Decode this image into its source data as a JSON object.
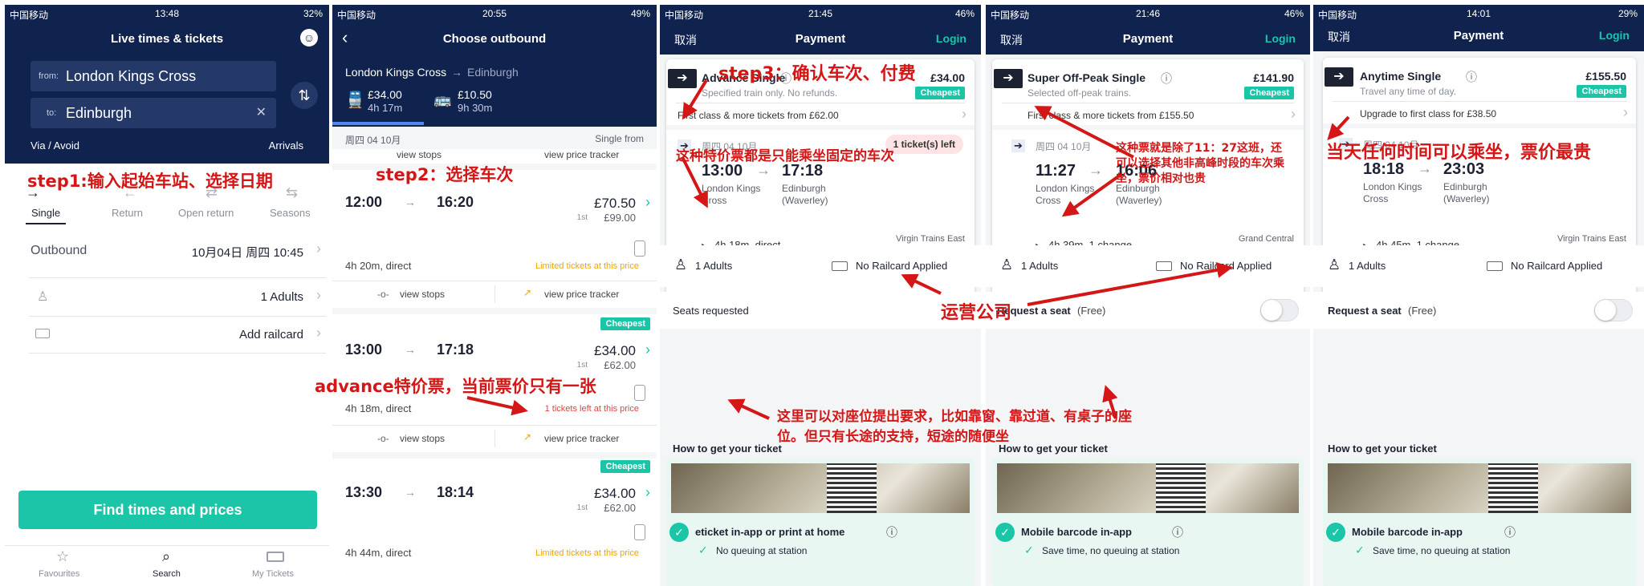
{
  "s1": {
    "status": {
      "carrier": "中国移动",
      "time": "13:48",
      "battery": "32%"
    },
    "title": "Live times & tickets",
    "from_label": "from:",
    "from_value": "London Kings Cross",
    "to_label": "to:",
    "to_value": "Edinburgh",
    "via": "Via / Avoid",
    "arrivals": "Arrivals",
    "types": [
      "Single",
      "Return",
      "Open return",
      "Seasons"
    ],
    "outbound_label": "Outbound",
    "outbound_value": "10月04日 周四 10:45",
    "adults": "1 Adults",
    "railcard": "Add railcard",
    "find": "Find times and prices",
    "tabs": [
      "Favourites",
      "Search",
      "My Tickets"
    ]
  },
  "s2": {
    "status": {
      "carrier": "中国移动",
      "time": "20:55",
      "battery": "49%"
    },
    "title": "Choose outbound",
    "route_from": "London Kings Cross",
    "route_to": "Edinburgh",
    "train_price": "£34.00",
    "train_dur": "4h 17m",
    "bus_price": "£10.50",
    "bus_dur": "9h 30m",
    "date": "周四 04 10月",
    "single_from": "Single from",
    "view_stops": "view stops",
    "view_tracker": "view price tracker",
    "cheapest": "Cheapest",
    "journeys": [
      {
        "dep": "12:00",
        "arr": "16:20",
        "price": "£70.50",
        "first_prefix": "1st",
        "first": "£99.00",
        "dur": "4h 20m, direct",
        "note": "Limited tickets at this price"
      },
      {
        "dep": "13:00",
        "arr": "17:18",
        "price": "£34.00",
        "first_prefix": "1st",
        "first": "£62.00",
        "dur": "4h 18m, direct",
        "note": "1 tickets left at this price"
      },
      {
        "dep": "13:30",
        "arr": "18:14",
        "price": "£34.00",
        "first_prefix": "1st",
        "first": "£62.00",
        "dur": "4h 44m, direct",
        "note": "Limited tickets at this price"
      }
    ]
  },
  "pay_common": {
    "cancel": "取消",
    "title": "Payment",
    "login": "Login",
    "adults": "1 Adults",
    "railcard": "No Railcard Applied",
    "how": "How to get your ticket",
    "save_time": "Save time, no queuing at station",
    "from_station": "London Kings Cross",
    "to_station": "Edinburgh (Waverley)",
    "date": "周四 04 10月",
    "cheapest": "Cheapest"
  },
  "s3": {
    "status": {
      "carrier": "中国移动",
      "time": "21:45",
      "battery": "46%"
    },
    "ticket": "Advance Single",
    "price": "£34.00",
    "desc": "Specified train only. No refunds.",
    "upgrade": "First class & more tickets from £62.00",
    "left": "1 ticket(s) left",
    "dep": "13:00",
    "arr": "17:18",
    "dur": "4h 18m, direct",
    "operator": "Virgin Trains East Coast",
    "seats": "Seats requested",
    "delivery": "eticket in-app or print at home",
    "no_queue": "No queuing at station"
  },
  "s4": {
    "status": {
      "carrier": "中国移动",
      "time": "21:46",
      "battery": "46%"
    },
    "ticket": "Super Off-Peak Single",
    "price": "£141.90",
    "desc": "Selected off-peak trains.",
    "upgrade": "First class & more tickets from £155.50",
    "dep": "11:27",
    "arr": "16:06",
    "dur": "4h 39m, 1 change",
    "operator": "Grand Central Railway",
    "seat_label": "Request a seat",
    "seat_free": "(Free)",
    "delivery": "Mobile barcode in-app"
  },
  "s5": {
    "status": {
      "carrier": "中国移动",
      "time": "14:01",
      "battery": "29%"
    },
    "ticket": "Anytime Single",
    "price": "£155.50",
    "desc": "Travel any time of day.",
    "upgrade": "Upgrade to first class for £38.50",
    "dep": "18:18",
    "arr": "23:03",
    "dur": "4h 45m, 1 change",
    "operator": "Virgin Trains East Coast",
    "seat_label": "Request a seat",
    "seat_free": "(Free)",
    "delivery": "Mobile barcode in-app"
  },
  "annotations": {
    "step1": "step1:输入起始车站、选择日期",
    "step2": "step2：选择车次",
    "step3": "step3：确认车次、付费",
    "advance_fixed": "这种特价票都是只能乘坐固定的车次",
    "advance_cheap": "advance特价票，当前票价只有一张",
    "offpeak": "这种票就是除了11：27这班，还可以选择其他非高峰时段的车次乘坐，票价相对也贵",
    "operator": "运营公司",
    "seats": "这里可以对座位提出要求，比如靠窗、靠过道、有桌子的座位。但只有长途的支持，短途的随便坐",
    "anytime": "当天任何时间可以乘坐，票价最贵"
  },
  "colors": {
    "navy": "#10234e",
    "teal": "#1bc5a8",
    "annotation": "#d41616",
    "limited": "#f0a500",
    "left": "#e0453a"
  }
}
